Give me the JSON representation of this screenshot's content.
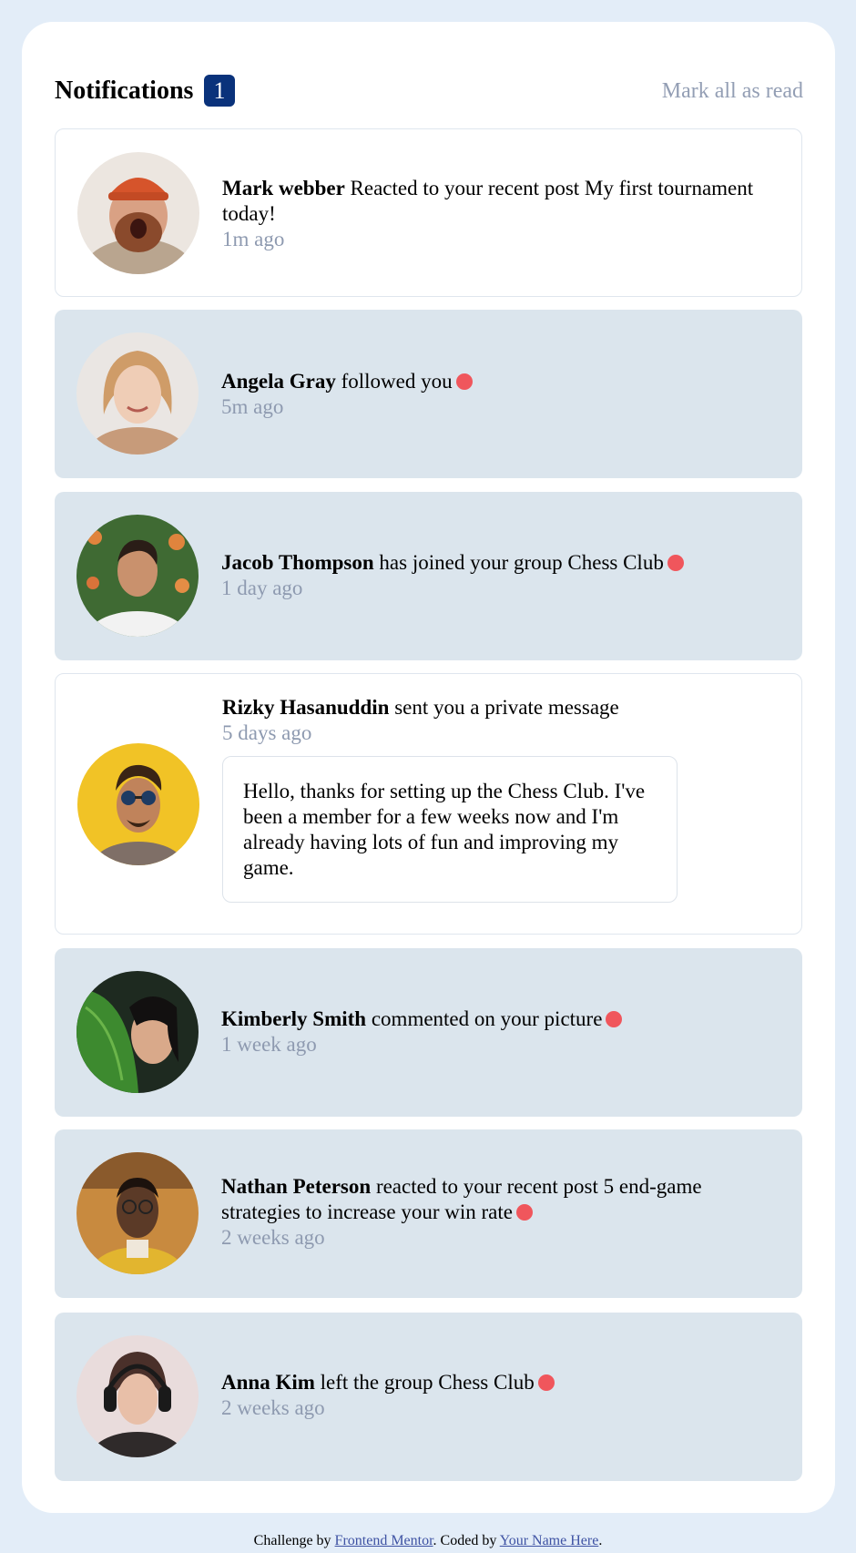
{
  "header": {
    "title": "Notifications",
    "unread_count": "1",
    "mark_all_label": "Mark all as read"
  },
  "notifications": [
    {
      "name": "Mark webber",
      "action": "Reacted to your recent post My first tournament today!",
      "time": "1m ago",
      "unread": false
    },
    {
      "name": "Angela Gray",
      "action": "followed you",
      "time": "5m ago",
      "unread": true
    },
    {
      "name": "Jacob Thompson",
      "action": "has joined your group Chess Club",
      "time": "1 day ago",
      "unread": true
    },
    {
      "name": "Rizky Hasanuddin",
      "action": "sent you a private message",
      "time": "5 days ago",
      "message": "Hello, thanks for setting up the Chess Club. I've been a member for a few weeks now and I'm already having lots of fun and improving my game.",
      "unread": false
    },
    {
      "name": "Kimberly Smith",
      "action": "commented on your picture",
      "time": "1 week ago",
      "unread": true
    },
    {
      "name": "Nathan Peterson",
      "action": "reacted to your recent post 5 end-game strategies to increase your win rate",
      "time": "2 weeks ago",
      "unread": true
    },
    {
      "name": "Anna Kim",
      "action": "left the group Chess Club",
      "time": "2 weeks ago",
      "unread": true
    }
  ],
  "footer": {
    "prefix": "Challenge by",
    "link1": "Frontend Mentor",
    "middle": ". Coded by",
    "link2": "Your Name Here",
    "suffix": "."
  },
  "colors": {
    "background": "#e3edf8",
    "card": "#ffffff",
    "unread_bg": "#dbe5ed",
    "badge": "#0a327b",
    "dot": "#f0565c",
    "muted": "#8e9ab0"
  },
  "icons": [
    "avatar-mark-webber",
    "avatar-angela-gray",
    "avatar-jacob-thompson",
    "avatar-rizky-hasanuddin",
    "avatar-kimberly-smith",
    "avatar-nathan-peterson",
    "avatar-anna-kim",
    "unread-dot-icon"
  ]
}
